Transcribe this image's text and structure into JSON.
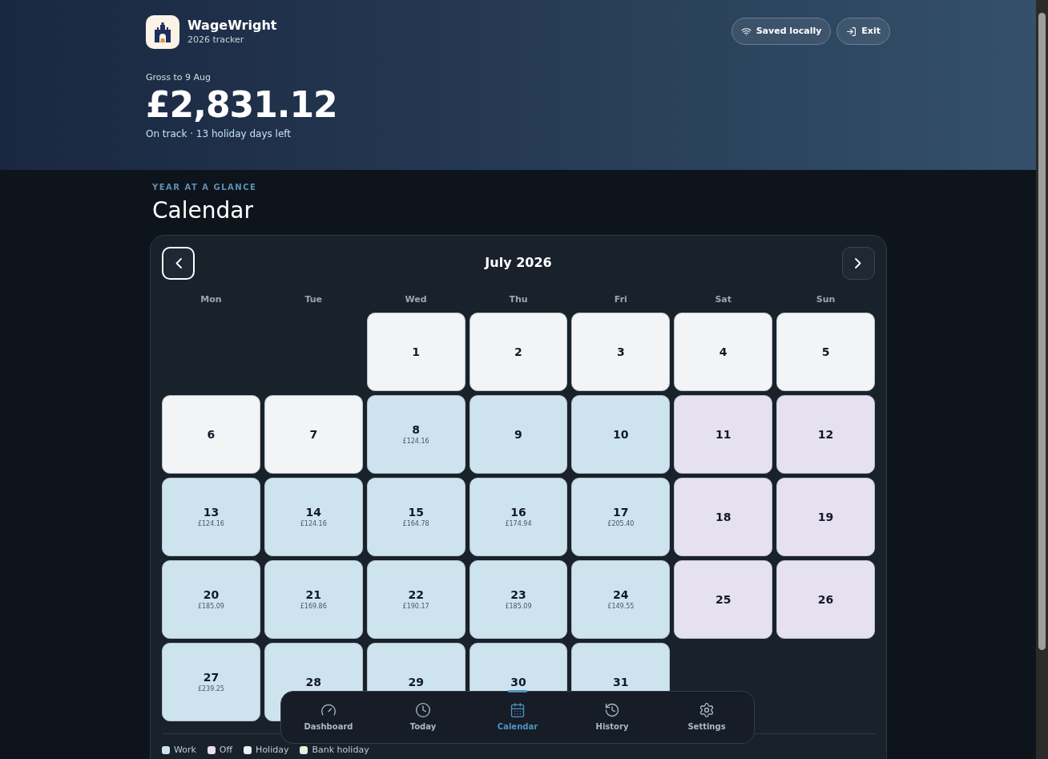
{
  "app": {
    "name": "WageWright",
    "subtitle": "2026 tracker"
  },
  "header_buttons": [
    {
      "kind": "wifi",
      "label": "Saved locally"
    },
    {
      "kind": "exit",
      "label": "Exit"
    }
  ],
  "summary": {
    "caption": "Gross to 9 Aug",
    "amount": "£2,831.12",
    "status": "On track · 13 holiday days left"
  },
  "section": {
    "eyebrow": "YEAR AT A GLANCE",
    "title": "Calendar"
  },
  "calendar": {
    "month": "July 2026",
    "weekdays": [
      "Mon",
      "Tue",
      "Wed",
      "Thu",
      "Fri",
      "Sat",
      "Sun"
    ],
    "cells": [
      {
        "kind": "blank"
      },
      {
        "kind": "blank"
      },
      {
        "kind": "day",
        "day": "1",
        "color": "#f3f4f6"
      },
      {
        "kind": "day",
        "day": "2",
        "color": "#f3f4f6"
      },
      {
        "kind": "day",
        "day": "3",
        "color": "#f3f4f6"
      },
      {
        "kind": "day",
        "day": "4",
        "color": "#f3f4f6"
      },
      {
        "kind": "day",
        "day": "5",
        "color": "#f3f4f6"
      },
      {
        "kind": "day",
        "day": "6",
        "color": "#f3f4f6"
      },
      {
        "kind": "day",
        "day": "7",
        "color": "#f3f4f6"
      },
      {
        "kind": "day",
        "day": "8",
        "amount": "£124.16",
        "color": "#cde4ef"
      },
      {
        "kind": "day",
        "day": "9",
        "color": "#cde4ef"
      },
      {
        "kind": "day",
        "day": "10",
        "color": "#cde4ef"
      },
      {
        "kind": "day",
        "day": "11",
        "color": "#e6e1f1"
      },
      {
        "kind": "day",
        "day": "12",
        "color": "#e6e1f1"
      },
      {
        "kind": "day",
        "day": "13",
        "amount": "£124.16",
        "color": "#cde4ef"
      },
      {
        "kind": "day",
        "day": "14",
        "amount": "£124.16",
        "color": "#cde4ef"
      },
      {
        "kind": "day",
        "day": "15",
        "amount": "£164.78",
        "color": "#cde4ef"
      },
      {
        "kind": "day",
        "day": "16",
        "amount": "£174.94",
        "color": "#cde4ef"
      },
      {
        "kind": "day",
        "day": "17",
        "amount": "£205.40",
        "color": "#cde4ef"
      },
      {
        "kind": "day",
        "day": "18",
        "color": "#e6e1f1"
      },
      {
        "kind": "day",
        "day": "19",
        "color": "#e6e1f1"
      },
      {
        "kind": "day",
        "day": "20",
        "amount": "£185.09",
        "color": "#cde4ef"
      },
      {
        "kind": "day",
        "day": "21",
        "amount": "£169.86",
        "color": "#cde4ef"
      },
      {
        "kind": "day",
        "day": "22",
        "amount": "£190.17",
        "color": "#cde4ef"
      },
      {
        "kind": "day",
        "day": "23",
        "amount": "£185.09",
        "color": "#cde4ef"
      },
      {
        "kind": "day",
        "day": "24",
        "amount": "£149.55",
        "color": "#cde4ef"
      },
      {
        "kind": "day",
        "day": "25",
        "color": "#e6e1f1"
      },
      {
        "kind": "day",
        "day": "26",
        "color": "#e6e1f1"
      },
      {
        "kind": "day",
        "day": "27",
        "amount": "£239.25",
        "color": "#cde4ef"
      },
      {
        "kind": "day",
        "day": "28",
        "color": "#cde4ef"
      },
      {
        "kind": "day",
        "day": "29",
        "color": "#cde4ef"
      },
      {
        "kind": "day",
        "day": "30",
        "color": "#cde4ef"
      },
      {
        "kind": "day",
        "day": "31",
        "color": "#cde4ef"
      }
    ]
  },
  "legend": [
    {
      "label": "Work",
      "color": "#cde4ef"
    },
    {
      "label": "Off",
      "color": "#e6e1f1"
    },
    {
      "label": "Holiday",
      "color": "#eceef6"
    },
    {
      "label": "Bank holiday",
      "color": "#e8f2da"
    }
  ],
  "bottom_nav": [
    {
      "kind": "dashboard",
      "label": "Dashboard",
      "selected": false
    },
    {
      "kind": "today",
      "label": "Today",
      "selected": false
    },
    {
      "kind": "calendar",
      "label": "Calendar",
      "selected": true
    },
    {
      "kind": "history",
      "label": "History",
      "selected": false
    },
    {
      "kind": "settings",
      "label": "Settings",
      "selected": false
    }
  ]
}
